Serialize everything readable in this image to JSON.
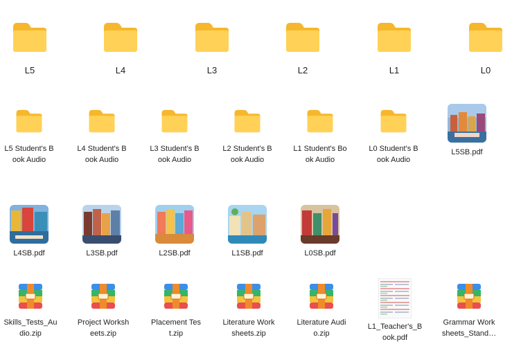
{
  "row1": [
    {
      "name": "L5",
      "kind": "folder",
      "icon": "folder-icon"
    },
    {
      "name": "L4",
      "kind": "folder",
      "icon": "folder-icon"
    },
    {
      "name": "L3",
      "kind": "folder",
      "icon": "folder-icon"
    },
    {
      "name": "L2",
      "kind": "folder",
      "icon": "folder-icon"
    },
    {
      "name": "L1",
      "kind": "folder",
      "icon": "folder-icon"
    },
    {
      "name": "L0",
      "kind": "folder",
      "icon": "folder-icon"
    }
  ],
  "row2": [
    {
      "line1": "L5 Student's B",
      "line2": "ook Audio",
      "kind": "folder",
      "icon": "folder-icon"
    },
    {
      "line1": "L4 Student's B",
      "line2": "ook Audio",
      "kind": "folder",
      "icon": "folder-icon"
    },
    {
      "line1": "L3 Student's B",
      "line2": "ook Audio",
      "kind": "folder",
      "icon": "folder-icon"
    },
    {
      "line1": "L2 Student's B",
      "line2": "ook Audio",
      "kind": "folder",
      "icon": "folder-icon"
    },
    {
      "line1": "L1 Student's Bo",
      "line2": "ok Audio",
      "kind": "folder",
      "icon": "folder-icon"
    },
    {
      "line1": "L0 Student's B",
      "line2": "ook Audio",
      "kind": "folder",
      "icon": "folder-icon"
    },
    {
      "line1": "L5SB.pdf",
      "line2": "",
      "kind": "pdf",
      "icon": "book-cover-icon"
    }
  ],
  "row3": [
    {
      "name": "L4SB.pdf",
      "kind": "pdf",
      "icon": "book-cover-icon"
    },
    {
      "name": "L3SB.pdf",
      "kind": "pdf",
      "icon": "book-cover-icon"
    },
    {
      "name": "L2SB.pdf",
      "kind": "pdf",
      "icon": "book-cover-icon"
    },
    {
      "name": "L1SB.pdf",
      "kind": "pdf",
      "icon": "book-cover-icon"
    },
    {
      "name": "L0SB.pdf",
      "kind": "pdf",
      "icon": "book-cover-icon"
    }
  ],
  "row4": [
    {
      "line1": "Skills_Tests_Au",
      "line2": "dio.zip",
      "kind": "zip",
      "icon": "archive-icon"
    },
    {
      "line1": "Project Worksh",
      "line2": "eets.zip",
      "kind": "zip",
      "icon": "archive-icon"
    },
    {
      "line1": "Placement Tes",
      "line2": "t.zip",
      "kind": "zip",
      "icon": "archive-icon"
    },
    {
      "line1": "Literature Work",
      "line2": "sheets.zip",
      "kind": "zip",
      "icon": "archive-icon"
    },
    {
      "line1": "Literature Audi",
      "line2": "o.zip",
      "kind": "zip",
      "icon": "archive-icon"
    },
    {
      "line1": "L1_Teacher's_B",
      "line2": "ook.pdf",
      "kind": "pdf",
      "icon": "document-page-icon"
    },
    {
      "line1": "Grammar Work",
      "line2": "sheets_Stand…",
      "kind": "zip",
      "icon": "archive-icon"
    }
  ],
  "colors": {
    "folder_back": "#f6c13a",
    "folder_front": "#ffd45a",
    "zip_blue": "#3d8ee8",
    "zip_green": "#36b46a",
    "zip_orange": "#f08b2c",
    "zip_red": "#e94f4f"
  }
}
